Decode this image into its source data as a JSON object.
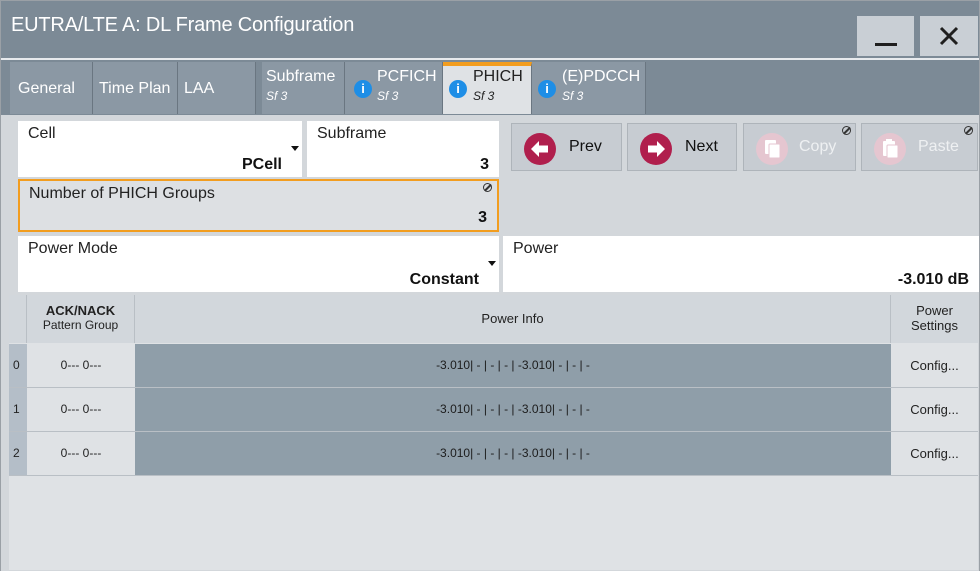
{
  "window": {
    "title": "EUTRA/LTE A: DL Frame Configuration"
  },
  "tabs": [
    {
      "label": "General",
      "sub": ""
    },
    {
      "label": "Time Plan",
      "sub": ""
    },
    {
      "label": "LAA",
      "sub": ""
    },
    {
      "label": "Subframe",
      "sub": "Sf 3"
    },
    {
      "label": "PCFICH",
      "sub": "Sf 3"
    },
    {
      "label": "PHICH",
      "sub": "Sf 3"
    },
    {
      "label": "(E)PDCCH",
      "sub": "Sf 3"
    }
  ],
  "form": {
    "cell": {
      "label": "Cell",
      "value": "PCell"
    },
    "subframe": {
      "label": "Subframe",
      "value": "3"
    },
    "prev_label": "Prev",
    "next_label": "Next",
    "copy_label": "Copy",
    "paste_label": "Paste",
    "groups": {
      "label": "Number of PHICH Groups",
      "value": "3"
    },
    "power_mode": {
      "label": "Power Mode",
      "value": "Constant"
    },
    "power": {
      "label": "Power",
      "value": "-3.010 dB"
    }
  },
  "table": {
    "headers": {
      "pattern_line1": "ACK/NACK",
      "pattern_line2": "Pattern Group",
      "power_info": "Power Info",
      "settings_line1": "Power",
      "settings_line2": "Settings"
    },
    "rows": [
      {
        "idx": "0",
        "pattern": "0--- 0---",
        "power": "-3.010| - | - | - | -3.010| - | - | -",
        "config": "Config..."
      },
      {
        "idx": "1",
        "pattern": "0--- 0---",
        "power": "-3.010| - | - | - | -3.010| - | - | -",
        "config": "Config..."
      },
      {
        "idx": "2",
        "pattern": "0--- 0---",
        "power": "-3.010| - | - | - | -3.010| - | - | -",
        "config": "Config..."
      }
    ]
  },
  "colors": {
    "titlebar": "#7c8a96",
    "accent": "#f29d1f",
    "button_red": "#b01f4d",
    "info_blue": "#1e8ee6"
  }
}
